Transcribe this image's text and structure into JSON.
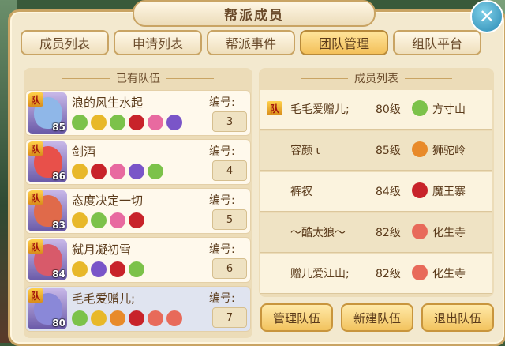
{
  "window": {
    "title": "帮派成员",
    "close_label": "✕"
  },
  "tabs": [
    {
      "label": "成员列表",
      "active": false
    },
    {
      "label": "申请列表",
      "active": false
    },
    {
      "label": "帮派事件",
      "active": false
    },
    {
      "label": "团队管理",
      "active": true
    },
    {
      "label": "组队平台",
      "active": false
    }
  ],
  "teams": {
    "header": "已有队伍",
    "number_label": "编号:",
    "rows": [
      {
        "name": "浪的风生水起",
        "level": "85",
        "number": "3",
        "leader_badge": "队",
        "face": "#8fb7e8",
        "icons": [
          "#7cc24a",
          "#e8b82a",
          "#7cc24a",
          "#c8232a",
          "#e86aa0",
          "#7a55c8"
        ]
      },
      {
        "name": "剑酒",
        "level": "86",
        "number": "4",
        "leader_badge": "队",
        "face": "#e8504a",
        "icons": [
          "#e8b82a",
          "#c8232a",
          "#e86aa0",
          "#7a55c8",
          "#7cc24a"
        ]
      },
      {
        "name": "态度决定一切",
        "level": "83",
        "number": "5",
        "leader_badge": "队",
        "face": "#e06a4a",
        "icons": [
          "#e8b82a",
          "#7cc24a",
          "#e86aa0",
          "#c8232a"
        ]
      },
      {
        "name": "弑月凝初雪",
        "level": "84",
        "number": "6",
        "leader_badge": "队",
        "face": "#d85a6a",
        "icons": [
          "#e8b82a",
          "#7a55c8",
          "#c8232a",
          "#7cc24a"
        ]
      },
      {
        "name": "毛毛爱赠儿;",
        "level": "80",
        "number": "7",
        "leader_badge": "队",
        "face": "#8a88d8",
        "icons": [
          "#7cc24a",
          "#e8b82a",
          "#e88a2a",
          "#c8232a",
          "#e86a5a",
          "#e86a5a"
        ]
      }
    ]
  },
  "members": {
    "header": "成员列表",
    "rows": [
      {
        "badge": "队",
        "name": "毛毛爱赠儿;",
        "level": "80级",
        "school": "方寸山",
        "school_color": "#7cc24a"
      },
      {
        "badge": "",
        "name": "容颜 ι",
        "level": "85级",
        "school": "狮驼岭",
        "school_color": "#e88a2a"
      },
      {
        "badge": "",
        "name": "裤衩",
        "level": "84级",
        "school": "魔王寨",
        "school_color": "#c8232a"
      },
      {
        "badge": "",
        "name": "～酷太狼～",
        "level": "82级",
        "school": "化生寺",
        "school_color": "#e86a5a"
      },
      {
        "badge": "",
        "name": "赠儿爱江山;",
        "level": "82级",
        "school": "化生寺",
        "school_color": "#e86a5a"
      }
    ]
  },
  "actions": {
    "manage": "管理队伍",
    "create": "新建队伍",
    "quit": "退出队伍"
  }
}
